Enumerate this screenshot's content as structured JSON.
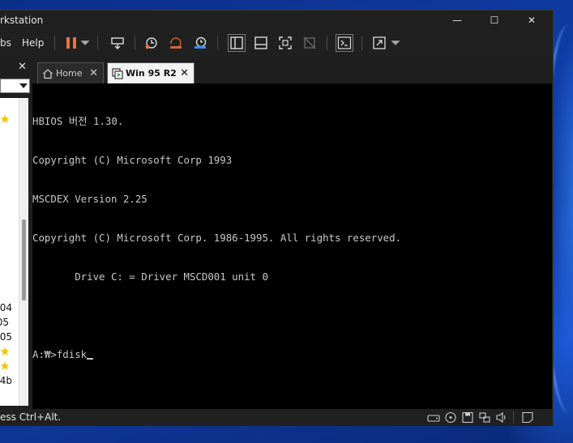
{
  "window": {
    "title": "rkstation",
    "minimize": "—",
    "maximize": "☐",
    "close": "✕"
  },
  "menu": {
    "tabs_label": "bs",
    "help_label": "Help"
  },
  "library": {
    "close": "✕",
    "items": [
      "04",
      "05",
      "05",
      "4b"
    ]
  },
  "tabs": [
    {
      "label": "Home",
      "close": "✕"
    },
    {
      "label": "Win 95 R2",
      "close": "✕"
    }
  ],
  "console": {
    "lines": [
      "HBIOS 버전 1.30.",
      "Copyright (C) Microsoft Corp 1993",
      "MSCDEX Version 2.25",
      "Copyright (C) Microsoft Corp. 1986-1995. All rights reserved.",
      "       Drive C: = Driver MSCD001 unit 0",
      "",
      "A:₩>fdisk"
    ]
  },
  "status": {
    "message": "ess Ctrl+Alt."
  },
  "colors": {
    "accent_orange": "#e8713c",
    "star": "#f5c400"
  }
}
